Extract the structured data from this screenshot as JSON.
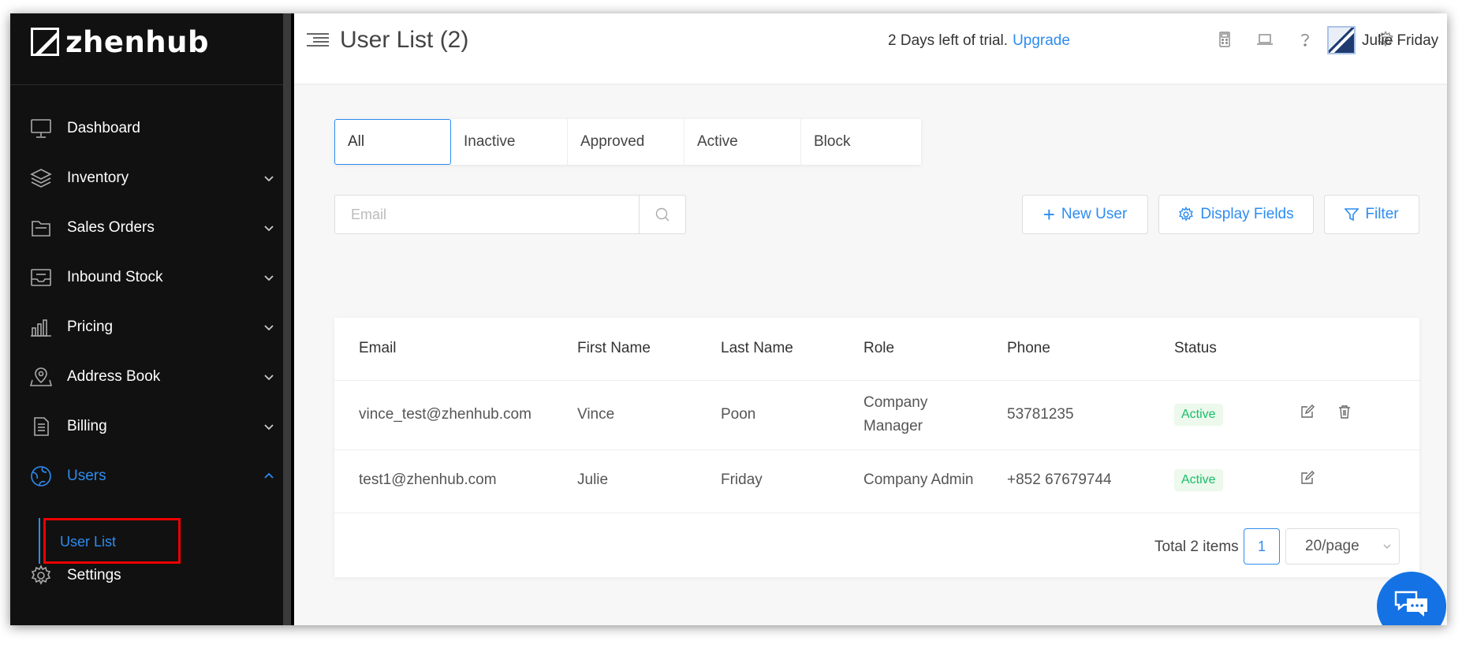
{
  "app": {
    "brand": "zhenhub"
  },
  "sidebar": {
    "items": [
      {
        "label": "Dashboard",
        "icon": "monitor-icon",
        "expandable": false
      },
      {
        "label": "Inventory",
        "icon": "layers-icon",
        "expandable": true
      },
      {
        "label": "Sales Orders",
        "icon": "folder-icon",
        "expandable": true
      },
      {
        "label": "Inbound Stock",
        "icon": "inbox-icon",
        "expandable": true
      },
      {
        "label": "Pricing",
        "icon": "bar-chart-icon",
        "expandable": true
      },
      {
        "label": "Address Book",
        "icon": "map-pin-icon",
        "expandable": true
      },
      {
        "label": "Billing",
        "icon": "document-icon",
        "expandable": true
      },
      {
        "label": "Users",
        "icon": "globe-icon",
        "expandable": true,
        "active": true
      },
      {
        "label": "Settings",
        "icon": "gear-icon",
        "expandable": false
      }
    ],
    "sub_item": {
      "label": "User List"
    },
    "accent_color": "#2d8cf0"
  },
  "header": {
    "title": "User List (2)",
    "trial_text": "2 Days left of trial.",
    "upgrade_label": "Upgrade",
    "user_name": "Julie Friday",
    "icons": [
      "calculator-icon",
      "laptop-icon",
      "help-icon",
      "bell-icon",
      "gear-icon"
    ]
  },
  "tabs": [
    "All",
    "Inactive",
    "Approved",
    "Active",
    "Block"
  ],
  "search": {
    "placeholder": "Email",
    "value": ""
  },
  "toolbar": {
    "new_user": "New User",
    "display_fields": "Display Fields",
    "filter": "Filter"
  },
  "table": {
    "columns": [
      "Email",
      "First Name",
      "Last Name",
      "Role",
      "Phone",
      "Status"
    ],
    "rows": [
      {
        "email": "vince_test@zhenhub.com",
        "first_name": "Vince",
        "last_name": "Poon",
        "role_line1": "Company",
        "role_line2": "Manager",
        "phone": "53781235",
        "status": "Active"
      },
      {
        "email": "test1@zhenhub.com",
        "first_name": "Julie",
        "last_name": "Friday",
        "role": "Company Admin",
        "phone": "+852 67679744",
        "status": "Active"
      }
    ]
  },
  "pagination": {
    "total": "Total 2 items",
    "current_page": "1",
    "page_size": "20/page"
  },
  "colors": {
    "primary": "#2d8cf0",
    "success": "#19be6b",
    "sidebar_bg": "#111111",
    "highlight_border": "#e00000"
  }
}
